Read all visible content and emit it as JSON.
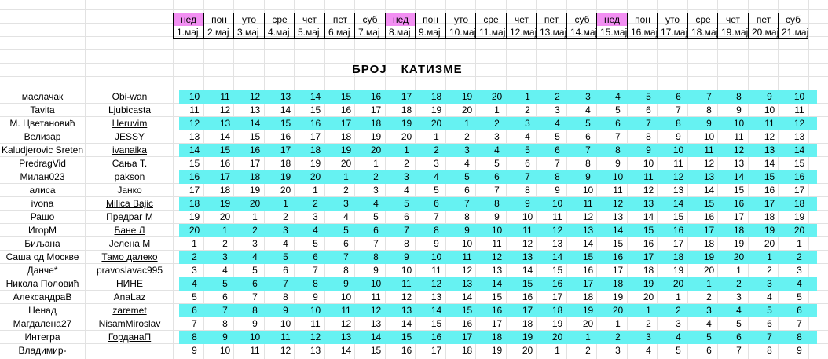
{
  "title": [
    "БРОЈ",
    "КАТИЗМЕ"
  ],
  "days": [
    "нед",
    "пон",
    "уто",
    "сре",
    "чет",
    "пет",
    "суб",
    "нед",
    "пон",
    "уто",
    "сре",
    "чет",
    "пет",
    "суб",
    "нед",
    "пон",
    "уто",
    "сре",
    "чет",
    "пет",
    "суб"
  ],
  "dates": [
    "1.мај",
    "2.мај",
    "3.мај",
    "4.мај",
    "5.мај",
    "6.мај",
    "7.мај",
    "8.мај",
    "9.мај",
    "10.мај",
    "11.мај",
    "12.мај",
    "13.мај",
    "14.мај",
    "15.мај",
    "16.мај",
    "17.мај",
    "18.мај",
    "19.мај",
    "20.мај",
    "21.мај"
  ],
  "colors": {
    "sunday": "#f28ff2",
    "highlight_row": "#66f2f2",
    "gridline": "#e2e2e2"
  },
  "rows": [
    {
      "left": "маслачак",
      "right": "Obi-wan",
      "cyan": true,
      "values": [
        10,
        11,
        12,
        13,
        14,
        15,
        16,
        17,
        18,
        19,
        20,
        1,
        2,
        3,
        4,
        5,
        6,
        7,
        8,
        9,
        10
      ]
    },
    {
      "left": "Tavita",
      "right": "Ljubicasta",
      "cyan": false,
      "values": [
        11,
        12,
        13,
        14,
        15,
        16,
        17,
        18,
        19,
        20,
        1,
        2,
        3,
        4,
        5,
        6,
        7,
        8,
        9,
        10,
        11
      ]
    },
    {
      "left": "М. Цветановић",
      "right": "Heruvim",
      "cyan": true,
      "values": [
        12,
        13,
        14,
        15,
        16,
        17,
        18,
        19,
        20,
        1,
        2,
        3,
        4,
        5,
        6,
        7,
        8,
        9,
        10,
        11,
        12
      ]
    },
    {
      "left": "Велизар",
      "right": "JESSY",
      "cyan": false,
      "values": [
        13,
        14,
        15,
        16,
        17,
        18,
        19,
        20,
        1,
        2,
        3,
        4,
        5,
        6,
        7,
        8,
        9,
        10,
        11,
        12,
        13
      ]
    },
    {
      "left": "Kaludjerovic Sreten",
      "right": "ivanaika",
      "cyan": true,
      "values": [
        14,
        15,
        16,
        17,
        18,
        19,
        20,
        1,
        2,
        3,
        4,
        5,
        6,
        7,
        8,
        9,
        10,
        11,
        12,
        13,
        14
      ]
    },
    {
      "left": "PredragVid",
      "right": "Сања Т.",
      "cyan": false,
      "values": [
        15,
        16,
        17,
        18,
        19,
        20,
        1,
        2,
        3,
        4,
        5,
        6,
        7,
        8,
        9,
        10,
        11,
        12,
        13,
        14,
        15
      ]
    },
    {
      "left": "Милан023",
      "right": "pakson",
      "cyan": true,
      "values": [
        16,
        17,
        18,
        19,
        20,
        1,
        2,
        3,
        4,
        5,
        6,
        7,
        8,
        9,
        10,
        11,
        12,
        13,
        14,
        15,
        16
      ]
    },
    {
      "left": "алиса",
      "right": "Јанко",
      "cyan": false,
      "values": [
        17,
        18,
        19,
        20,
        1,
        2,
        3,
        4,
        5,
        6,
        7,
        8,
        9,
        10,
        11,
        12,
        13,
        14,
        15,
        16,
        17
      ]
    },
    {
      "left": "ivona",
      "right": "Milica Bajic",
      "cyan": true,
      "values": [
        18,
        19,
        20,
        1,
        2,
        3,
        4,
        5,
        6,
        7,
        8,
        9,
        10,
        11,
        12,
        13,
        14,
        15,
        16,
        17,
        18
      ]
    },
    {
      "left": "Рашо",
      "right": "Предраг М",
      "cyan": false,
      "values": [
        19,
        20,
        1,
        2,
        3,
        4,
        5,
        6,
        7,
        8,
        9,
        10,
        11,
        12,
        13,
        14,
        15,
        16,
        17,
        18,
        19
      ]
    },
    {
      "left": "ИгорМ",
      "right": "Бане Л",
      "cyan": true,
      "values": [
        20,
        1,
        2,
        3,
        4,
        5,
        6,
        7,
        8,
        9,
        10,
        11,
        12,
        13,
        14,
        15,
        16,
        17,
        18,
        19,
        20
      ]
    },
    {
      "left": "Биљана",
      "right": "Јелена М",
      "cyan": false,
      "values": [
        1,
        2,
        3,
        4,
        5,
        6,
        7,
        8,
        9,
        10,
        11,
        12,
        13,
        14,
        15,
        16,
        17,
        18,
        19,
        20,
        1
      ]
    },
    {
      "left": "Саша од Москве",
      "right": "Тамо далеко",
      "cyan": true,
      "values": [
        2,
        3,
        4,
        5,
        6,
        7,
        8,
        9,
        10,
        11,
        12,
        13,
        14,
        15,
        16,
        17,
        18,
        19,
        20,
        1,
        2
      ]
    },
    {
      "left": "Данче*",
      "right": "pravoslavac995",
      "cyan": false,
      "values": [
        3,
        4,
        5,
        6,
        7,
        8,
        9,
        10,
        11,
        12,
        13,
        14,
        15,
        16,
        17,
        18,
        19,
        20,
        1,
        2,
        3
      ]
    },
    {
      "left": "Никола Половић",
      "right": "НИНЕ",
      "cyan": true,
      "values": [
        4,
        5,
        6,
        7,
        8,
        9,
        10,
        11,
        12,
        13,
        14,
        15,
        16,
        17,
        18,
        19,
        20,
        1,
        2,
        3,
        4
      ]
    },
    {
      "left": "АлександраВ",
      "right": "AnaLaz",
      "cyan": false,
      "values": [
        5,
        6,
        7,
        8,
        9,
        10,
        11,
        12,
        13,
        14,
        15,
        16,
        17,
        18,
        19,
        20,
        1,
        2,
        3,
        4,
        5
      ]
    },
    {
      "left": "Ненад",
      "right": "zaremet",
      "cyan": true,
      "values": [
        6,
        7,
        8,
        9,
        10,
        11,
        12,
        13,
        14,
        15,
        16,
        17,
        18,
        19,
        20,
        1,
        2,
        3,
        4,
        5,
        6
      ]
    },
    {
      "left": "Магдалена27",
      "right": "NisamMiroslav",
      "cyan": false,
      "values": [
        7,
        8,
        9,
        10,
        11,
        12,
        13,
        14,
        15,
        16,
        17,
        18,
        19,
        20,
        1,
        2,
        3,
        4,
        5,
        6,
        7
      ]
    },
    {
      "left": "Интегра",
      "right": "ГорданаП",
      "cyan": true,
      "values": [
        8,
        9,
        10,
        11,
        12,
        13,
        14,
        15,
        16,
        17,
        18,
        19,
        20,
        1,
        2,
        3,
        4,
        5,
        6,
        7,
        8
      ]
    },
    {
      "left": "Владимир-",
      "right": "",
      "cyan": false,
      "values": [
        9,
        10,
        11,
        12,
        13,
        14,
        15,
        16,
        17,
        18,
        19,
        20,
        1,
        2,
        3,
        4,
        5,
        6,
        7,
        8,
        9
      ]
    }
  ]
}
